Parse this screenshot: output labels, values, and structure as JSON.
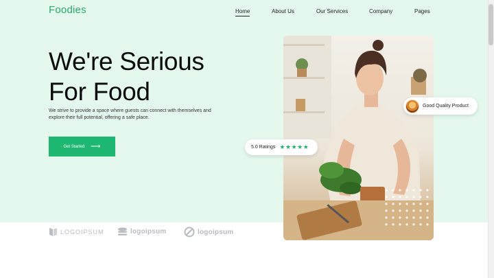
{
  "brand": {
    "name": "Foodies"
  },
  "nav": {
    "items": [
      {
        "label": "Home",
        "active": true
      },
      {
        "label": "About Us",
        "active": false
      },
      {
        "label": "Our Services",
        "active": false
      },
      {
        "label": "Company",
        "active": false
      },
      {
        "label": "Pages",
        "active": false
      }
    ]
  },
  "hero": {
    "title_line1": "We're Serious",
    "title_line2": "For Food",
    "subtitle": "We strive to provide a space where guests can connect with themselves and explore their full potential, offering a safe place.",
    "cta_label": "Get Started",
    "cta_icon": "arrow-right-icon"
  },
  "badges": {
    "rating_text": "5.0 Ratings",
    "rating_stars": 5,
    "quality_text": "Good Quality Product"
  },
  "partners": [
    {
      "name": "LOGOIPSUM",
      "icon": "logoipsum-mark-icon"
    },
    {
      "name": "logoipsum",
      "icon": "logoipsum-stack-icon"
    },
    {
      "name": "logoipsum",
      "icon": "logoipsum-circle-icon"
    }
  ],
  "colors": {
    "accent": "#1fb873",
    "brand_text": "#27a96a",
    "hero_bg": "#e4f8ee",
    "partner_gray": "#b9bcc2"
  }
}
